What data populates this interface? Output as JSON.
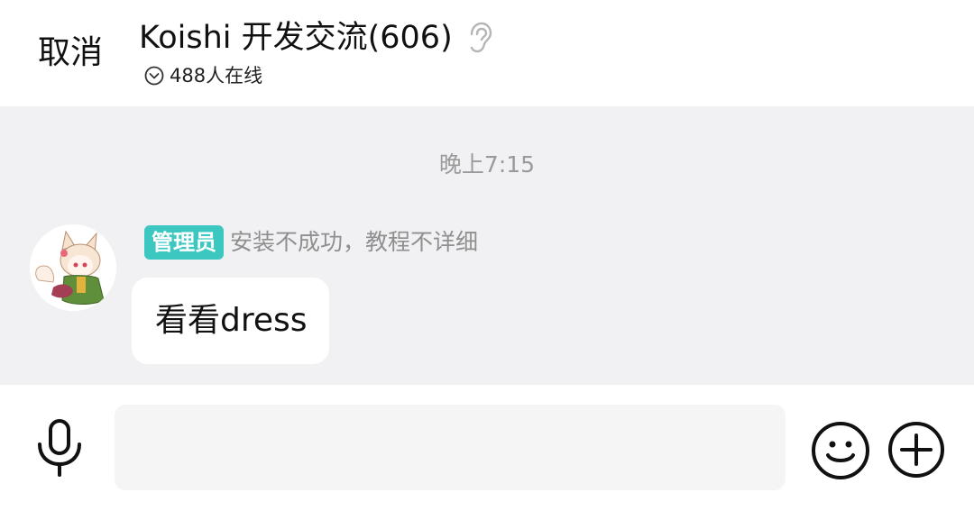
{
  "header": {
    "cancel_label": "取消",
    "title": "Koishi 开发交流(606)",
    "online_text": "488人在线"
  },
  "chat": {
    "timestamp": "晚上7:15",
    "messages": [
      {
        "badge": "管理员",
        "sender": "安装不成功，教程不详细",
        "text": "看看dress"
      }
    ]
  },
  "input_bar": {
    "placeholder": ""
  },
  "colors": {
    "chat_background": "#f1f1f3",
    "badge": "#3cc8c1",
    "timestamp": "#9a9a9a",
    "sender_name": "#8f8f8f"
  },
  "icons": {
    "ear": "ear-icon",
    "chevron": "chevron-down-circle-icon",
    "mic": "microphone-icon",
    "emoji": "smiley-icon",
    "plus": "plus-circle-icon"
  }
}
